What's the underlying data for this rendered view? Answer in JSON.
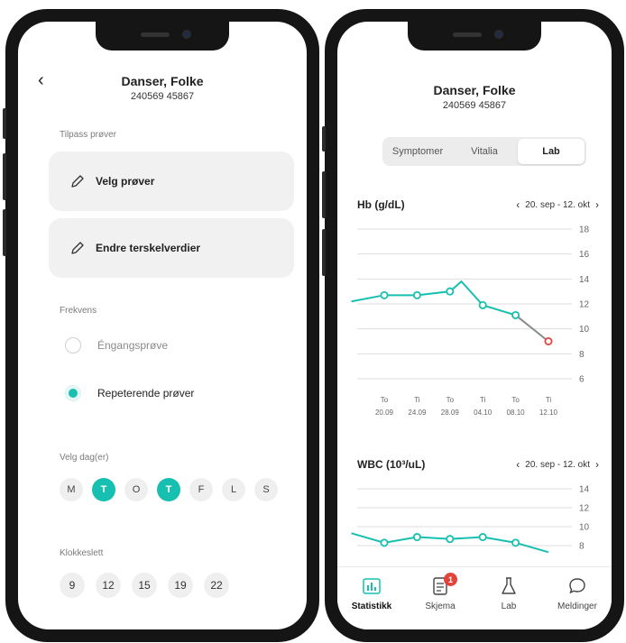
{
  "colors": {
    "accent": "#17bfb0",
    "alert": "#e2433b",
    "chip": "#efefef",
    "card": "#f1f1f1"
  },
  "left": {
    "patient": {
      "name": "Danser, Folke",
      "id": "240569 45867"
    },
    "customize_label": "Tilpass prøver",
    "select_tests": "Velg prøver",
    "change_thresholds": "Endre terskelverdier",
    "frequency_label": "Frekvens",
    "frequency_options": [
      {
        "label": "Éngangsprøve",
        "selected": false
      },
      {
        "label": "Repeterende prøver",
        "selected": true
      }
    ],
    "days_label": "Velg dag(er)",
    "days": [
      {
        "label": "M",
        "selected": false
      },
      {
        "label": "T",
        "selected": true
      },
      {
        "label": "O",
        "selected": false
      },
      {
        "label": "T",
        "selected": true
      },
      {
        "label": "F",
        "selected": false
      },
      {
        "label": "L",
        "selected": false
      },
      {
        "label": "S",
        "selected": false
      }
    ],
    "time_label": "Klokkeslett",
    "times": [
      "9",
      "12",
      "15",
      "19",
      "22"
    ]
  },
  "right": {
    "patient": {
      "name": "Danser, Folke",
      "id": "240569 45867"
    },
    "tabs": [
      "Symptomer",
      "Vitalia",
      "Lab"
    ],
    "active_tab": "Lab",
    "bottom_nav": [
      {
        "label": "Statistikk",
        "icon": "bar-chart-icon",
        "active": true
      },
      {
        "label": "Skjema",
        "icon": "form-icon",
        "badge": "1"
      },
      {
        "label": "Lab",
        "icon": "flask-icon"
      },
      {
        "label": "Meldinger",
        "icon": "chat-bubble-icon"
      }
    ]
  },
  "chart_data": [
    {
      "type": "line",
      "title": "Hb (g/dL)",
      "date_range": "20. sep - 12. okt",
      "yticks": [
        6,
        8,
        10,
        12,
        14,
        16,
        18
      ],
      "ylim": [
        6,
        18
      ],
      "xticks": [
        {
          "day": "To",
          "date": "20.09"
        },
        {
          "day": "Ti",
          "date": "24.09"
        },
        {
          "day": "To",
          "date": "28.09"
        },
        {
          "day": "Ti",
          "date": "04.10"
        },
        {
          "day": "To",
          "date": "08.10"
        },
        {
          "day": "Ti",
          "date": "12.10"
        }
      ],
      "series": [
        {
          "values": [
            12.2,
            12.7,
            12.7,
            13.0,
            13.8,
            11.9,
            11.1,
            9.0
          ],
          "x_index": [
            -1,
            0,
            1,
            2,
            2.35,
            3,
            4,
            5
          ],
          "markers": [
            false,
            true,
            true,
            true,
            false,
            true,
            true,
            true
          ],
          "alert_last": true
        }
      ],
      "grid": true
    },
    {
      "type": "line",
      "title": "WBC (10³/uL)",
      "date_range": "20. sep - 12. okt",
      "yticks": [
        8,
        10,
        12,
        14
      ],
      "ylim": [
        6,
        14
      ],
      "series": [
        {
          "values": [
            9.3,
            8.3,
            8.9,
            8.7,
            8.9,
            8.3,
            7.3
          ],
          "x_index": [
            -1,
            0,
            1,
            2,
            3,
            4,
            5
          ],
          "markers": [
            false,
            true,
            true,
            true,
            true,
            true,
            false
          ]
        }
      ],
      "grid": true
    }
  ]
}
